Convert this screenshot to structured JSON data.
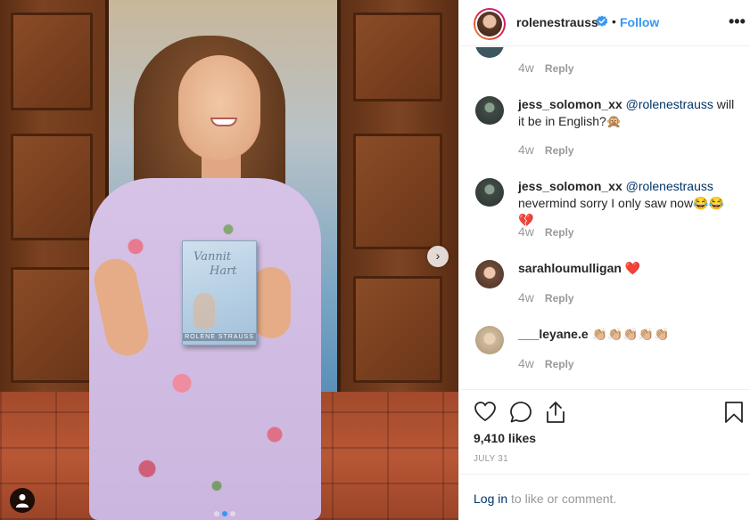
{
  "post": {
    "book_title_line1": "Vannit",
    "book_title_line2": "Hart",
    "book_author": "ROLENE STRAUSS",
    "carousel_count": 3,
    "carousel_active_index": 1
  },
  "header": {
    "username": "rolenestrauss",
    "separator": "•",
    "follow_label": "Follow",
    "more_label": "•••"
  },
  "comments": [
    {
      "time": "4w",
      "reply_label": "Reply"
    },
    {
      "username": "jess_solomon_xx",
      "mention": "@rolenestrauss",
      "text": " will it be in English?🙊",
      "time": "4w",
      "reply_label": "Reply",
      "avatar_color": "#3f4a45"
    },
    {
      "username": "jess_solomon_xx",
      "mention": "@rolenestrauss",
      "text": " nevermind sorry I only saw now😂😂💔",
      "time": "4w",
      "reply_label": "Reply",
      "avatar_color": "#3f4a45"
    },
    {
      "username": "sarahloumulligan",
      "mention": "",
      "text": " ❤️",
      "time": "4w",
      "reply_label": "Reply",
      "avatar_color": "#6b4a3a"
    },
    {
      "username": "___leyane.e",
      "mention": "",
      "text": " 👏🏼👏🏼👏🏼👏🏼👏🏼",
      "time": "4w",
      "reply_label": "Reply",
      "avatar_color": "#cdb89b"
    }
  ],
  "engagement": {
    "likes": "9,410 likes",
    "date": "JULY 31"
  },
  "login": {
    "link": "Log in",
    "rest": " to like or comment."
  },
  "colors": {
    "accent": "#3897f0",
    "text": "#262626",
    "muted": "#999999",
    "mention": "#003569",
    "verified": "#3897f0",
    "heart": "#ed4956"
  },
  "icons": {
    "like": "heart-icon",
    "comment": "comment-icon",
    "share": "share-icon",
    "save": "bookmark-icon",
    "verified": "verified-badge-icon",
    "next": "chevron-right-icon",
    "tag": "user-tag-icon"
  }
}
